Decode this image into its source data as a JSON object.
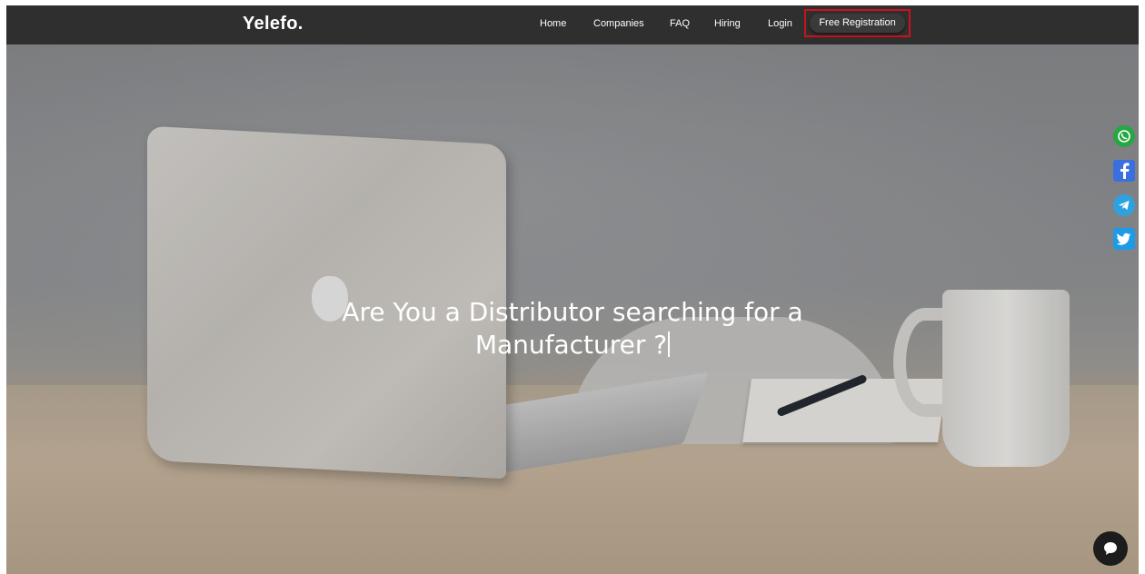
{
  "brand": {
    "name": "Yelefo."
  },
  "nav": {
    "items": [
      {
        "label": "Home"
      },
      {
        "label": "Companies"
      },
      {
        "label": "FAQ"
      },
      {
        "label": "Hiring"
      },
      {
        "label": "Login"
      }
    ],
    "cta_label": "Free Registration"
  },
  "hero": {
    "headline_line1": "Are You a Distributor searching for a",
    "headline_line2": "Manufacturer ?"
  },
  "social": {
    "icons": [
      "whatsapp-icon",
      "facebook-icon",
      "telegram-icon",
      "twitter-icon"
    ]
  },
  "chat": {
    "icon": "chat-bubble-icon"
  },
  "colors": {
    "navbar": "#2f2f2f",
    "highlight_border": "#d0101c",
    "whatsapp": "#25a743",
    "facebook": "#3b6fe0",
    "telegram": "#2ea2e0",
    "twitter": "#1d9be6"
  }
}
